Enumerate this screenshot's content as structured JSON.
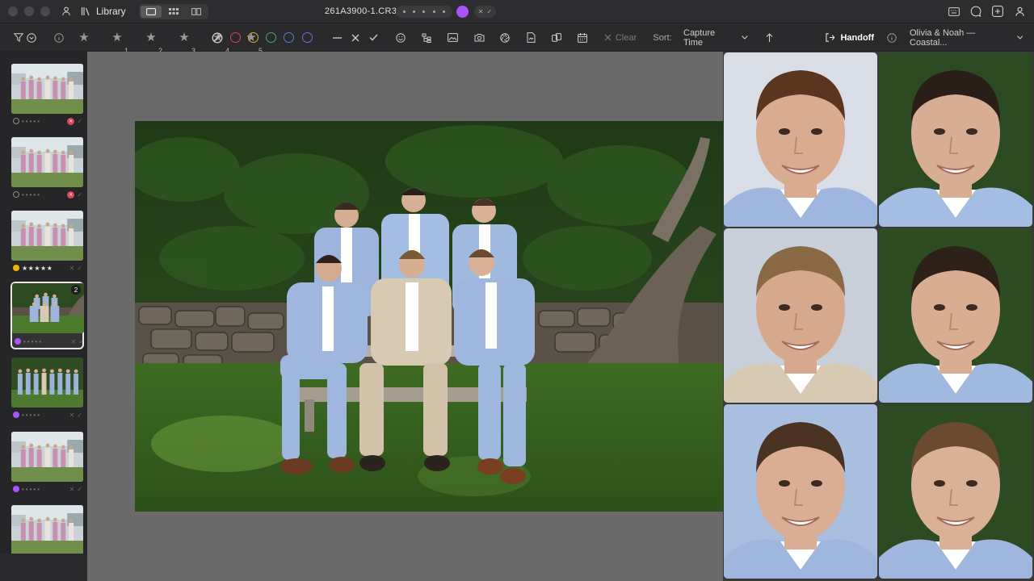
{
  "titlebar": {
    "library_label": "Library",
    "filename": "261A3900-1.CR3",
    "label_color": "#a855f7",
    "icons": [
      "person-icon",
      "library-icon",
      "single-view-icon",
      "grid-view-icon",
      "compare-view-icon",
      "keyboard-icon",
      "chat-icon",
      "add-icon",
      "account-icon"
    ]
  },
  "toolbar": {
    "star_filters": [
      {
        "sub": ""
      },
      {
        "sub": "1"
      },
      {
        "sub": "2"
      },
      {
        "sub": "3"
      },
      {
        "sub": "4"
      },
      {
        "sub": "5"
      }
    ],
    "color_filters": [
      {
        "name": "red",
        "hex": "#d0475a"
      },
      {
        "name": "yellow",
        "hex": "#c8b43a"
      },
      {
        "name": "green",
        "hex": "#3fae6a"
      },
      {
        "name": "blue",
        "hex": "#4f7fd6"
      },
      {
        "name": "purple",
        "hex": "#8f5bd8"
      }
    ],
    "clear_label": "Clear",
    "sort_label": "Sort:",
    "sort_value": "Capture Time",
    "handoff_label": "Handoff",
    "collection_label": "Olivia & Noah — Coastal..."
  },
  "sidebar": {
    "thumbnails": [
      {
        "scene": "bridesmaids",
        "status": "rejected",
        "label": "none",
        "rating": 0
      },
      {
        "scene": "bridesmaids",
        "status": "rejected",
        "label": "none",
        "rating": 0
      },
      {
        "scene": "bridesmaids",
        "status": "rated",
        "label": "yellow",
        "rating": 5,
        "stars": "★★★★★"
      },
      {
        "scene": "groomsmen-sitting",
        "status": "selected",
        "label": "purple",
        "rating": 0,
        "stack_count": "2"
      },
      {
        "scene": "groomsmen-standing",
        "status": "none",
        "label": "purple",
        "rating": 0
      },
      {
        "scene": "bridesmaids",
        "status": "none",
        "label": "purple",
        "rating": 0
      },
      {
        "scene": "bridesmaids",
        "status": "none",
        "label": "purple",
        "rating": 0
      }
    ]
  },
  "stack_popover": {
    "items": [
      {
        "state": "current",
        "label": "purple"
      },
      {
        "state": "accepted",
        "label": "none"
      }
    ]
  },
  "faces": {
    "count": 6
  }
}
